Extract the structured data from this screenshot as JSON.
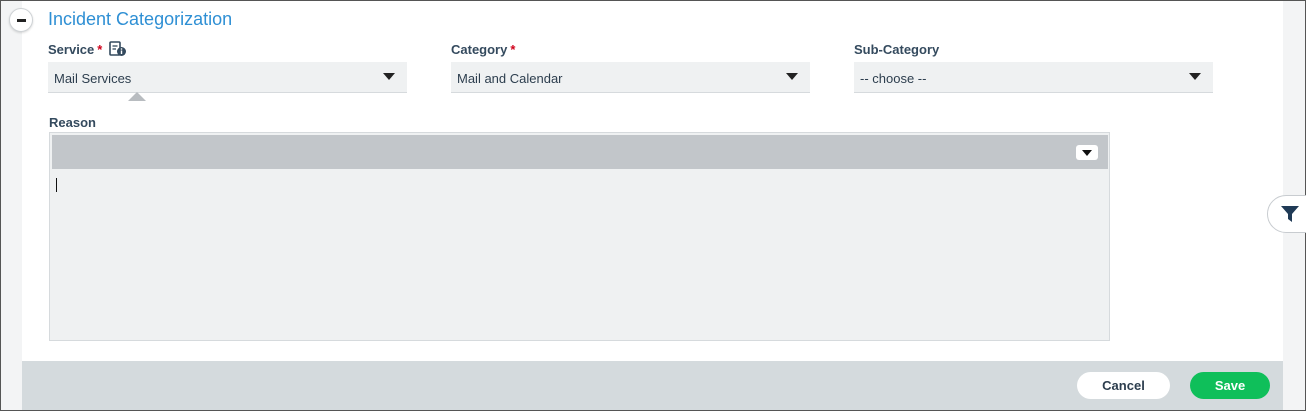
{
  "section": {
    "title": "Incident Categorization",
    "collapse_icon": "minus-icon"
  },
  "fields": {
    "service": {
      "label": "Service",
      "required_mark": "*",
      "value": "Mail Services",
      "info_icon": "info-document-icon"
    },
    "category": {
      "label": "Category",
      "required_mark": "*",
      "value": "Mail and Calendar"
    },
    "subcategory": {
      "label": "Sub-Category",
      "value": "-- choose --"
    },
    "reason": {
      "label": "Reason",
      "value": ""
    }
  },
  "side": {
    "filter_icon": "filter-icon"
  },
  "footer": {
    "cancel_label": "Cancel",
    "save_label": "Save"
  },
  "colors": {
    "title": "#2e8fd4",
    "required": "#d0021b",
    "save": "#0fbf5a",
    "footer_bg": "#d4dadd"
  }
}
